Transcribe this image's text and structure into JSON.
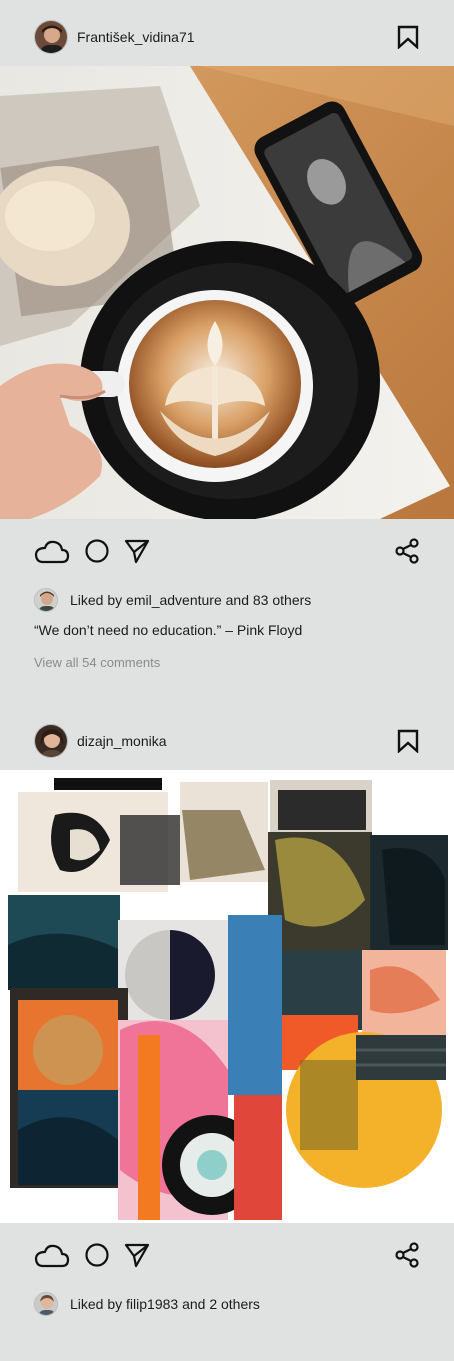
{
  "posts": [
    {
      "username": "František_vidina71",
      "likes_text": "Liked by emil_adventure and 83 others",
      "caption": "“We don’t need no education.” – Pink Floyd",
      "view_comments": "View all 54 comments",
      "icons": [
        "avatar",
        "bookmark-icon",
        "cloud-icon",
        "circle-icon",
        "send-icon",
        "share-icon"
      ]
    },
    {
      "username": "dizajn_monika",
      "likes_text": "Liked by filip1983 and 2 others",
      "icons": [
        "avatar",
        "bookmark-icon",
        "cloud-icon",
        "circle-icon",
        "send-icon",
        "share-icon"
      ]
    }
  ],
  "colors": {
    "background": "#e0e2e1",
    "text": "#1c1c1c",
    "muted": "#8a8c8b"
  }
}
